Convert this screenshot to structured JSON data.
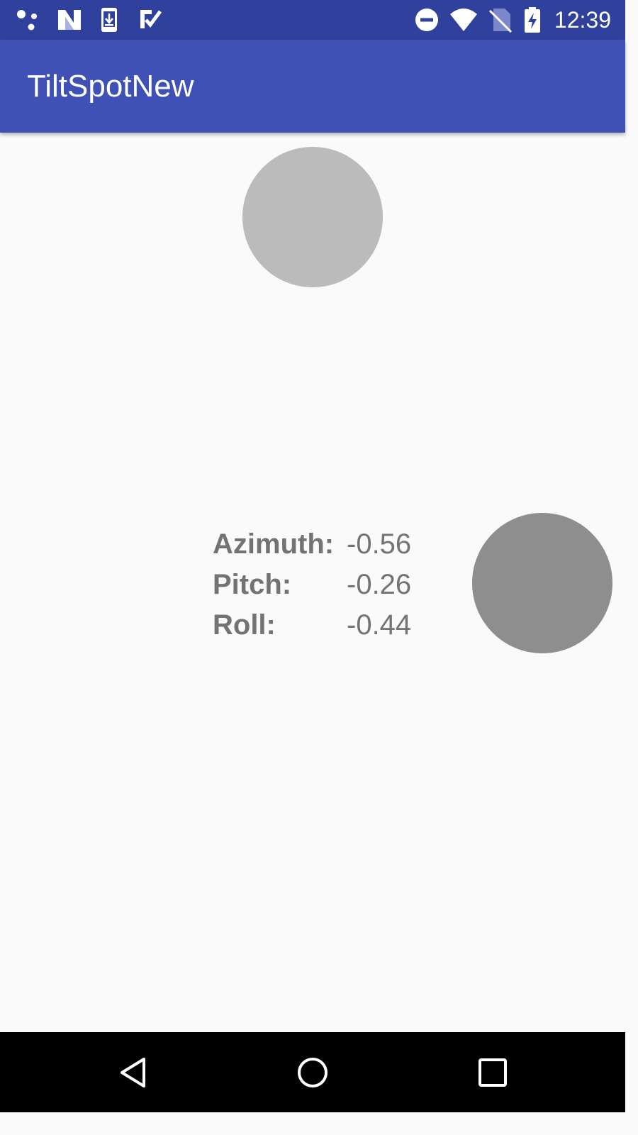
{
  "status_bar": {
    "icons": [
      "cluster-dots-icon",
      "n-letter-icon",
      "download-icon",
      "check-clipboard-icon",
      "do-not-disturb-icon",
      "wifi-icon",
      "no-sim-icon",
      "battery-charging-icon"
    ],
    "time": "12:39"
  },
  "app_bar": {
    "title": "TiltSpotNew"
  },
  "spots": {
    "top_color": "#bbbbbb",
    "right_color": "#8e8e8e"
  },
  "readings": {
    "azimuth_label": "Azimuth:",
    "azimuth_value": "-0.56",
    "pitch_label": "Pitch:",
    "pitch_value": "-0.26",
    "roll_label": "Roll:",
    "roll_value": "-0.44"
  },
  "nav_bar": {
    "icons": [
      "back-icon",
      "home-icon",
      "recents-icon"
    ]
  }
}
